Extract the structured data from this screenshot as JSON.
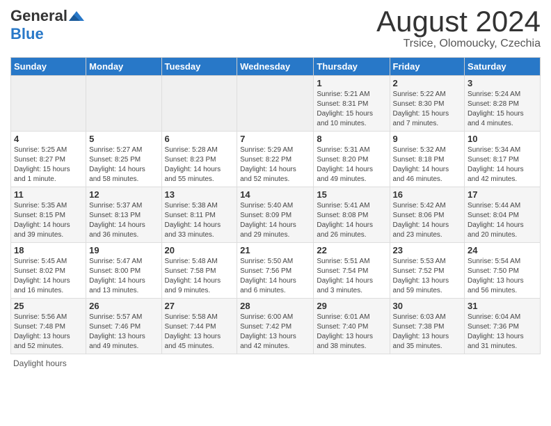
{
  "header": {
    "logo": {
      "general": "General",
      "blue": "Blue"
    },
    "title": "August 2024",
    "location": "Trsice, Olomoucky, Czechia"
  },
  "calendar": {
    "days_of_week": [
      "Sunday",
      "Monday",
      "Tuesday",
      "Wednesday",
      "Thursday",
      "Friday",
      "Saturday"
    ],
    "weeks": [
      [
        {
          "day": "",
          "info": ""
        },
        {
          "day": "",
          "info": ""
        },
        {
          "day": "",
          "info": ""
        },
        {
          "day": "",
          "info": ""
        },
        {
          "day": "1",
          "info": "Sunrise: 5:21 AM\nSunset: 8:31 PM\nDaylight: 15 hours\nand 10 minutes."
        },
        {
          "day": "2",
          "info": "Sunrise: 5:22 AM\nSunset: 8:30 PM\nDaylight: 15 hours\nand 7 minutes."
        },
        {
          "day": "3",
          "info": "Sunrise: 5:24 AM\nSunset: 8:28 PM\nDaylight: 15 hours\nand 4 minutes."
        }
      ],
      [
        {
          "day": "4",
          "info": "Sunrise: 5:25 AM\nSunset: 8:27 PM\nDaylight: 15 hours\nand 1 minute."
        },
        {
          "day": "5",
          "info": "Sunrise: 5:27 AM\nSunset: 8:25 PM\nDaylight: 14 hours\nand 58 minutes."
        },
        {
          "day": "6",
          "info": "Sunrise: 5:28 AM\nSunset: 8:23 PM\nDaylight: 14 hours\nand 55 minutes."
        },
        {
          "day": "7",
          "info": "Sunrise: 5:29 AM\nSunset: 8:22 PM\nDaylight: 14 hours\nand 52 minutes."
        },
        {
          "day": "8",
          "info": "Sunrise: 5:31 AM\nSunset: 8:20 PM\nDaylight: 14 hours\nand 49 minutes."
        },
        {
          "day": "9",
          "info": "Sunrise: 5:32 AM\nSunset: 8:18 PM\nDaylight: 14 hours\nand 46 minutes."
        },
        {
          "day": "10",
          "info": "Sunrise: 5:34 AM\nSunset: 8:17 PM\nDaylight: 14 hours\nand 42 minutes."
        }
      ],
      [
        {
          "day": "11",
          "info": "Sunrise: 5:35 AM\nSunset: 8:15 PM\nDaylight: 14 hours\nand 39 minutes."
        },
        {
          "day": "12",
          "info": "Sunrise: 5:37 AM\nSunset: 8:13 PM\nDaylight: 14 hours\nand 36 minutes."
        },
        {
          "day": "13",
          "info": "Sunrise: 5:38 AM\nSunset: 8:11 PM\nDaylight: 14 hours\nand 33 minutes."
        },
        {
          "day": "14",
          "info": "Sunrise: 5:40 AM\nSunset: 8:09 PM\nDaylight: 14 hours\nand 29 minutes."
        },
        {
          "day": "15",
          "info": "Sunrise: 5:41 AM\nSunset: 8:08 PM\nDaylight: 14 hours\nand 26 minutes."
        },
        {
          "day": "16",
          "info": "Sunrise: 5:42 AM\nSunset: 8:06 PM\nDaylight: 14 hours\nand 23 minutes."
        },
        {
          "day": "17",
          "info": "Sunrise: 5:44 AM\nSunset: 8:04 PM\nDaylight: 14 hours\nand 20 minutes."
        }
      ],
      [
        {
          "day": "18",
          "info": "Sunrise: 5:45 AM\nSunset: 8:02 PM\nDaylight: 14 hours\nand 16 minutes."
        },
        {
          "day": "19",
          "info": "Sunrise: 5:47 AM\nSunset: 8:00 PM\nDaylight: 14 hours\nand 13 minutes."
        },
        {
          "day": "20",
          "info": "Sunrise: 5:48 AM\nSunset: 7:58 PM\nDaylight: 14 hours\nand 9 minutes."
        },
        {
          "day": "21",
          "info": "Sunrise: 5:50 AM\nSunset: 7:56 PM\nDaylight: 14 hours\nand 6 minutes."
        },
        {
          "day": "22",
          "info": "Sunrise: 5:51 AM\nSunset: 7:54 PM\nDaylight: 14 hours\nand 3 minutes."
        },
        {
          "day": "23",
          "info": "Sunrise: 5:53 AM\nSunset: 7:52 PM\nDaylight: 13 hours\nand 59 minutes."
        },
        {
          "day": "24",
          "info": "Sunrise: 5:54 AM\nSunset: 7:50 PM\nDaylight: 13 hours\nand 56 minutes."
        }
      ],
      [
        {
          "day": "25",
          "info": "Sunrise: 5:56 AM\nSunset: 7:48 PM\nDaylight: 13 hours\nand 52 minutes."
        },
        {
          "day": "26",
          "info": "Sunrise: 5:57 AM\nSunset: 7:46 PM\nDaylight: 13 hours\nand 49 minutes."
        },
        {
          "day": "27",
          "info": "Sunrise: 5:58 AM\nSunset: 7:44 PM\nDaylight: 13 hours\nand 45 minutes."
        },
        {
          "day": "28",
          "info": "Sunrise: 6:00 AM\nSunset: 7:42 PM\nDaylight: 13 hours\nand 42 minutes."
        },
        {
          "day": "29",
          "info": "Sunrise: 6:01 AM\nSunset: 7:40 PM\nDaylight: 13 hours\nand 38 minutes."
        },
        {
          "day": "30",
          "info": "Sunrise: 6:03 AM\nSunset: 7:38 PM\nDaylight: 13 hours\nand 35 minutes."
        },
        {
          "day": "31",
          "info": "Sunrise: 6:04 AM\nSunset: 7:36 PM\nDaylight: 13 hours\nand 31 minutes."
        }
      ]
    ]
  },
  "footer": {
    "label": "Daylight hours"
  }
}
